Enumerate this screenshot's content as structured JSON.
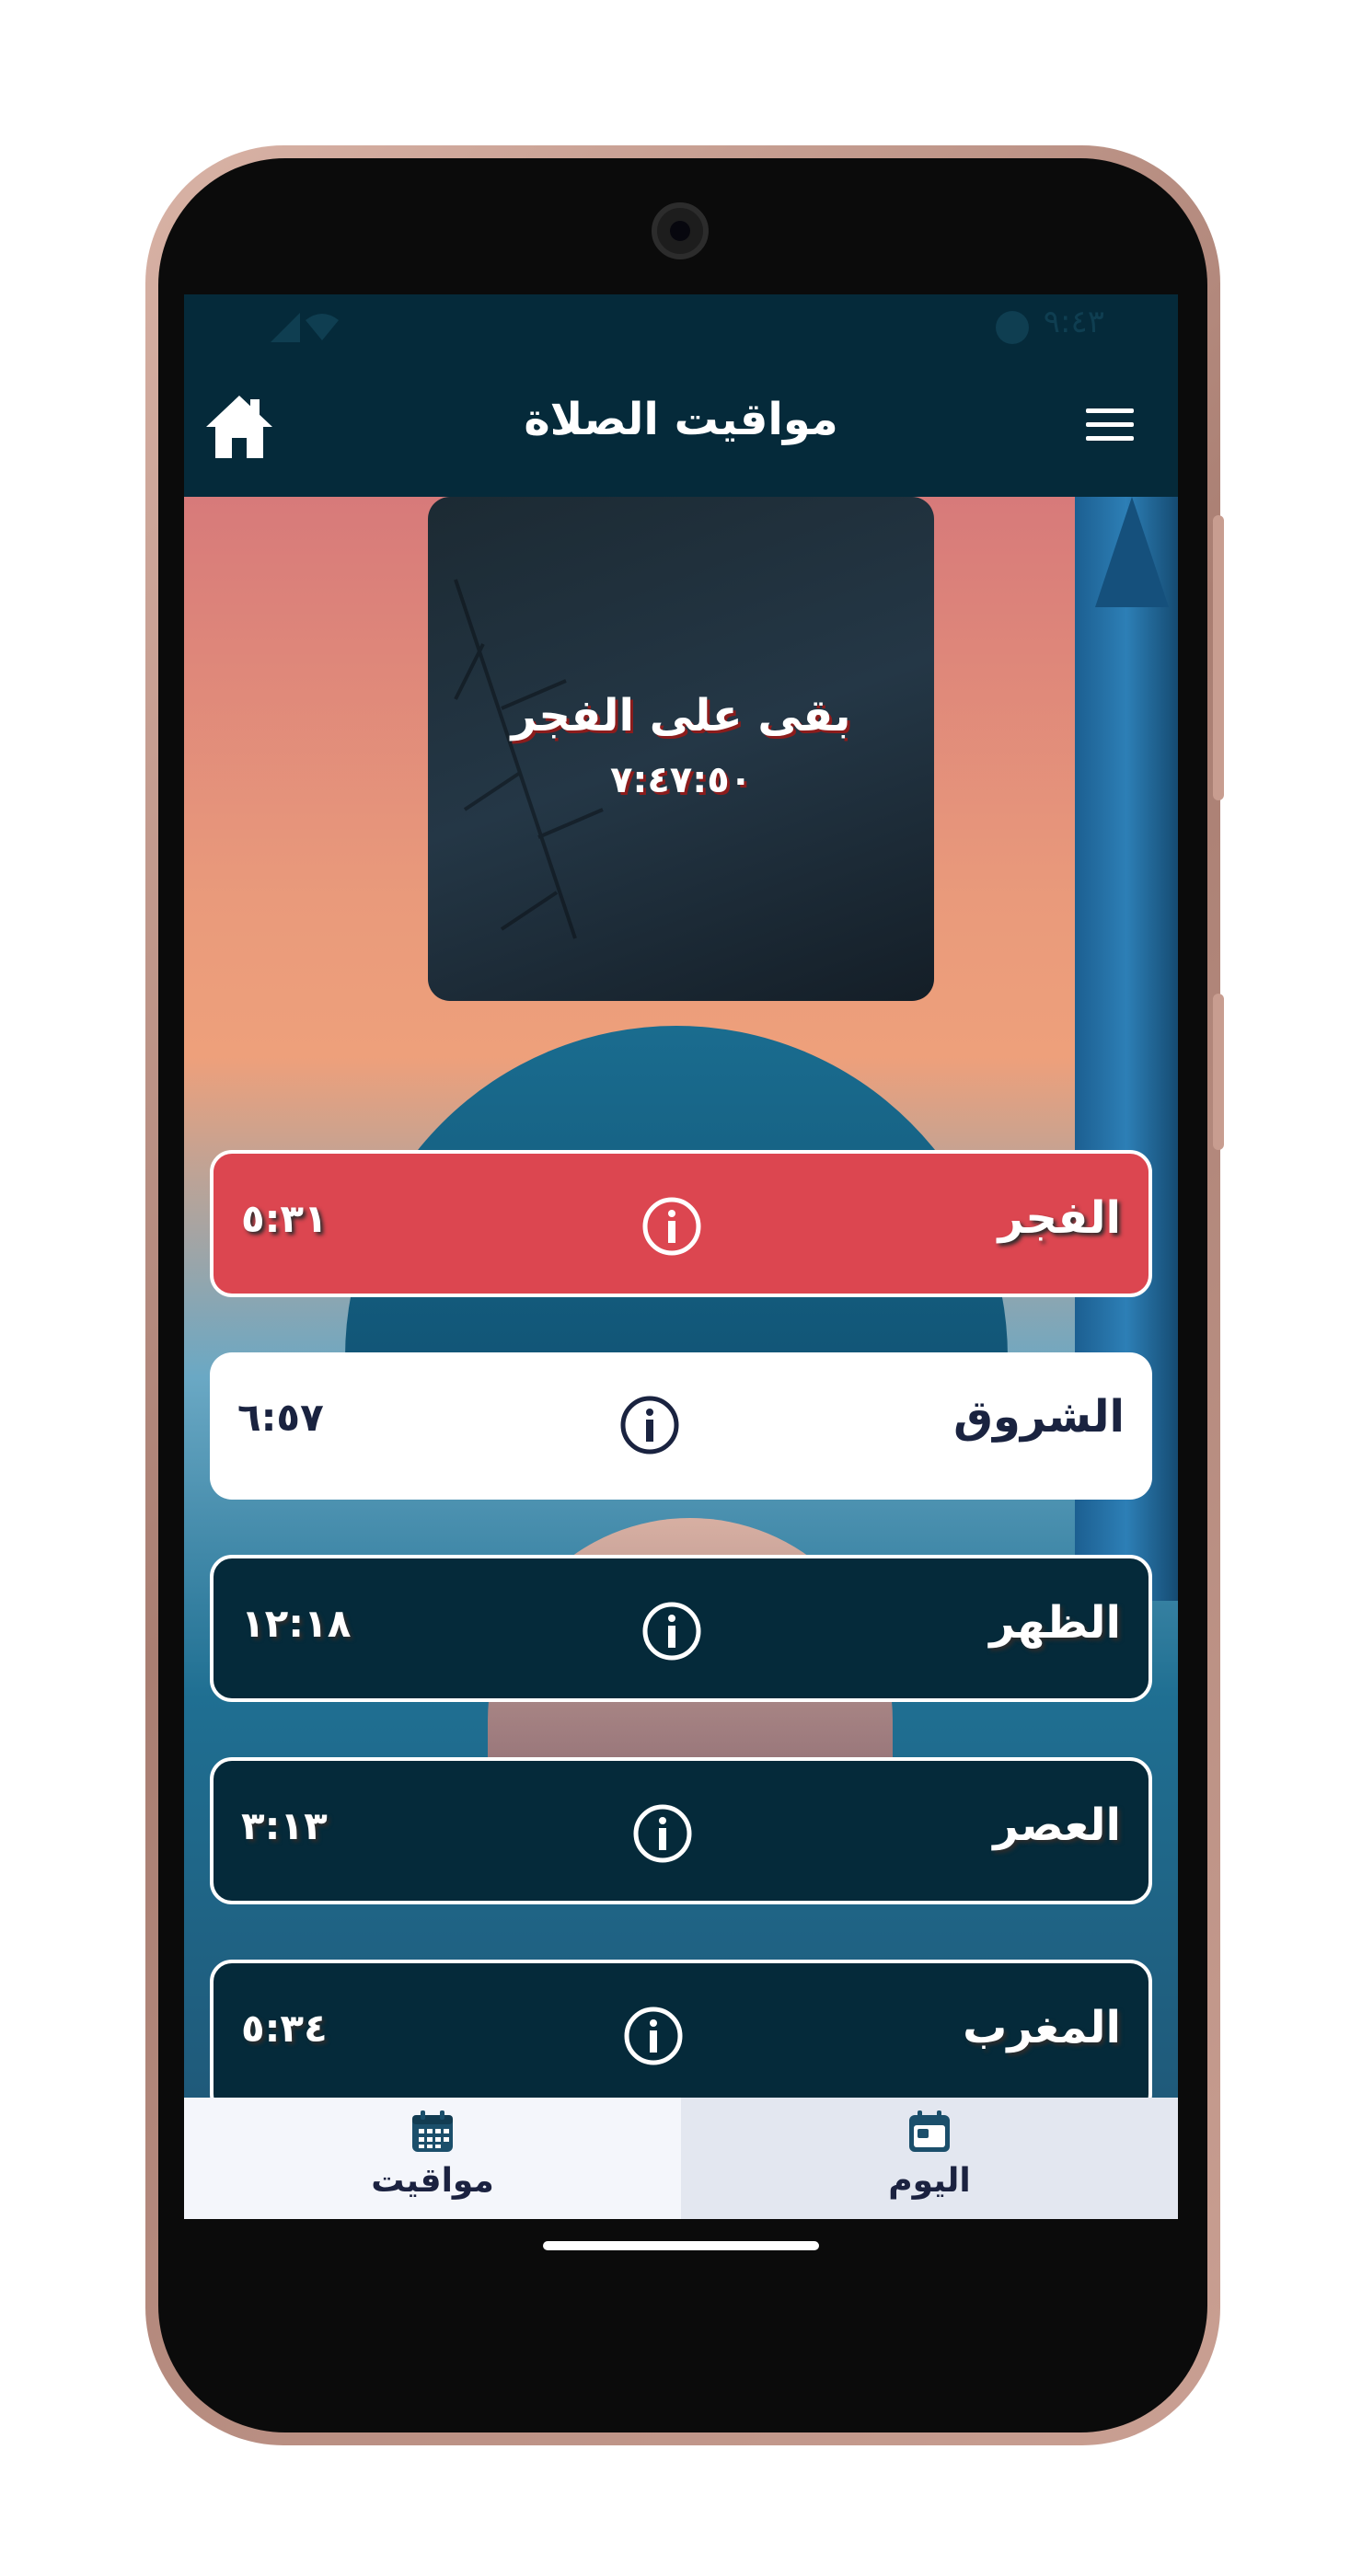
{
  "statusbar": {
    "time": "٩:٤٣"
  },
  "appbar": {
    "title": "مواقيت الصلاة"
  },
  "countdown": {
    "label": "بقى على الفجر",
    "remaining": "٧:٤٧:٥٠"
  },
  "prayers": [
    {
      "name": "الفجر",
      "time": "٥:٣١",
      "state": "active"
    },
    {
      "name": "الشروق",
      "time": "٦:٥٧",
      "state": "light"
    },
    {
      "name": "الظهر",
      "time": "١٢:١٨",
      "state": "dark"
    },
    {
      "name": "العصر",
      "time": "٣:١٣",
      "state": "dark"
    },
    {
      "name": "المغرب",
      "time": "٥:٣٤",
      "state": "dark"
    }
  ],
  "bottom_nav": [
    {
      "label": "مواقيت",
      "icon": "calendar-grid-icon"
    },
    {
      "label": "اليوم",
      "icon": "calendar-day-icon",
      "selected": true
    }
  ],
  "colors": {
    "primary": "#052a3a",
    "active": "#dc4650",
    "white": "#ffffff"
  }
}
